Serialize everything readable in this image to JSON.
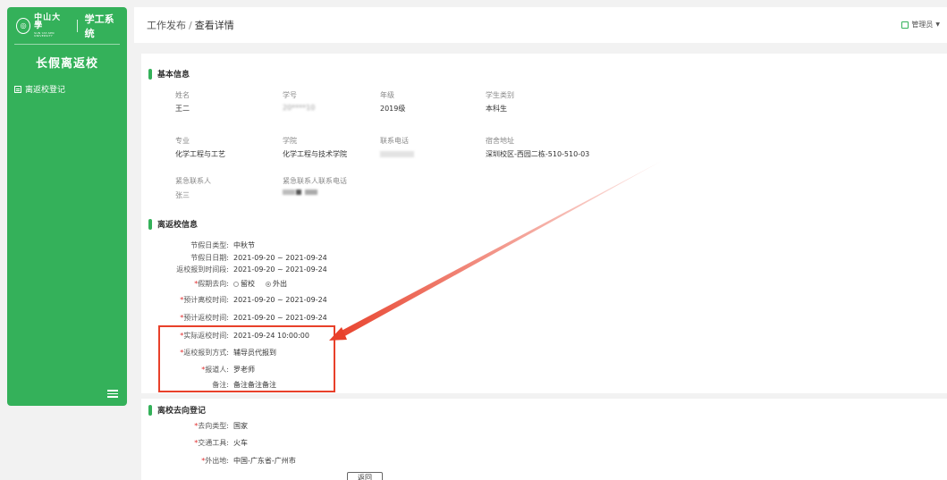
{
  "sidebar": {
    "logo_cn": "中山大學",
    "logo_en": "SUN YAT-SEN UNIVERSITY",
    "system_name": "学工系统",
    "module_title": "长假离返校",
    "nav": [
      {
        "label": "离返校登记",
        "icon": "list-icon"
      }
    ]
  },
  "header": {
    "crumb_parent": "工作发布",
    "crumb_sep": "/",
    "crumb_current": "查看详情",
    "user": "管理员"
  },
  "basic": {
    "title": "基本信息",
    "fields": {
      "name_label": "姓名",
      "name_value": "王二",
      "sid_label": "学号",
      "sid_value": "20****10",
      "grade_label": "年级",
      "grade_value": "2019级",
      "type_label": "学生类别",
      "type_value": "本科生",
      "major_label": "专业",
      "major_value": "化学工程与工艺",
      "college_label": "学院",
      "college_value": "化学工程与技术学院",
      "phone_label": "联系电话",
      "dorm_label": "宿舍地址",
      "dorm_value": "深圳校区-西园二栋-510-510-03",
      "emergency_label": "紧急联系人",
      "emergency_value": "张三",
      "emergency_phone_label": "紧急联系人联系电话"
    }
  },
  "leave": {
    "title": "离返校信息",
    "holiday_type_label": "节假日类型:",
    "holiday_type_value": "中秋节",
    "holiday_date_label": "节假日日期:",
    "holiday_date_value": "2021-09-20 ~ 2021-09-24",
    "report_period_label": "返校报到时间段:",
    "report_period_value": "2021-09-20 ~ 2021-09-24",
    "destination_label": "假期去向:",
    "opt_stay": "留校",
    "opt_out": "外出",
    "plan_leave_label": "预计离校时间:",
    "plan_leave_value": "2021-09-20 ~ 2021-09-24",
    "plan_return_label": "预计返校时间:",
    "plan_return_value": "2021-09-20 ~ 2021-09-24",
    "actual_return_label": "实际返校时间:",
    "actual_return_value": "2021-09-24 10:00:00",
    "report_method_label": "返校报到方式:",
    "report_method_value": "辅导员代报到",
    "reporter_label": "报道人:",
    "reporter_value": "罗老师",
    "remark_label": "备注:",
    "remark_value": "备注备注备注"
  },
  "trip": {
    "title": "离校去向登记",
    "dest_type_label": "去向类型:",
    "dest_type_value": "国家",
    "transport_label": "交通工具:",
    "transport_value": "火车",
    "place_label": "外出地:",
    "place_value": "中国-广东省-广州市"
  },
  "back_button": "返回",
  "colors": {
    "accent": "#34b15a",
    "annotation": "#e8402a",
    "required": "#e02d2d"
  }
}
